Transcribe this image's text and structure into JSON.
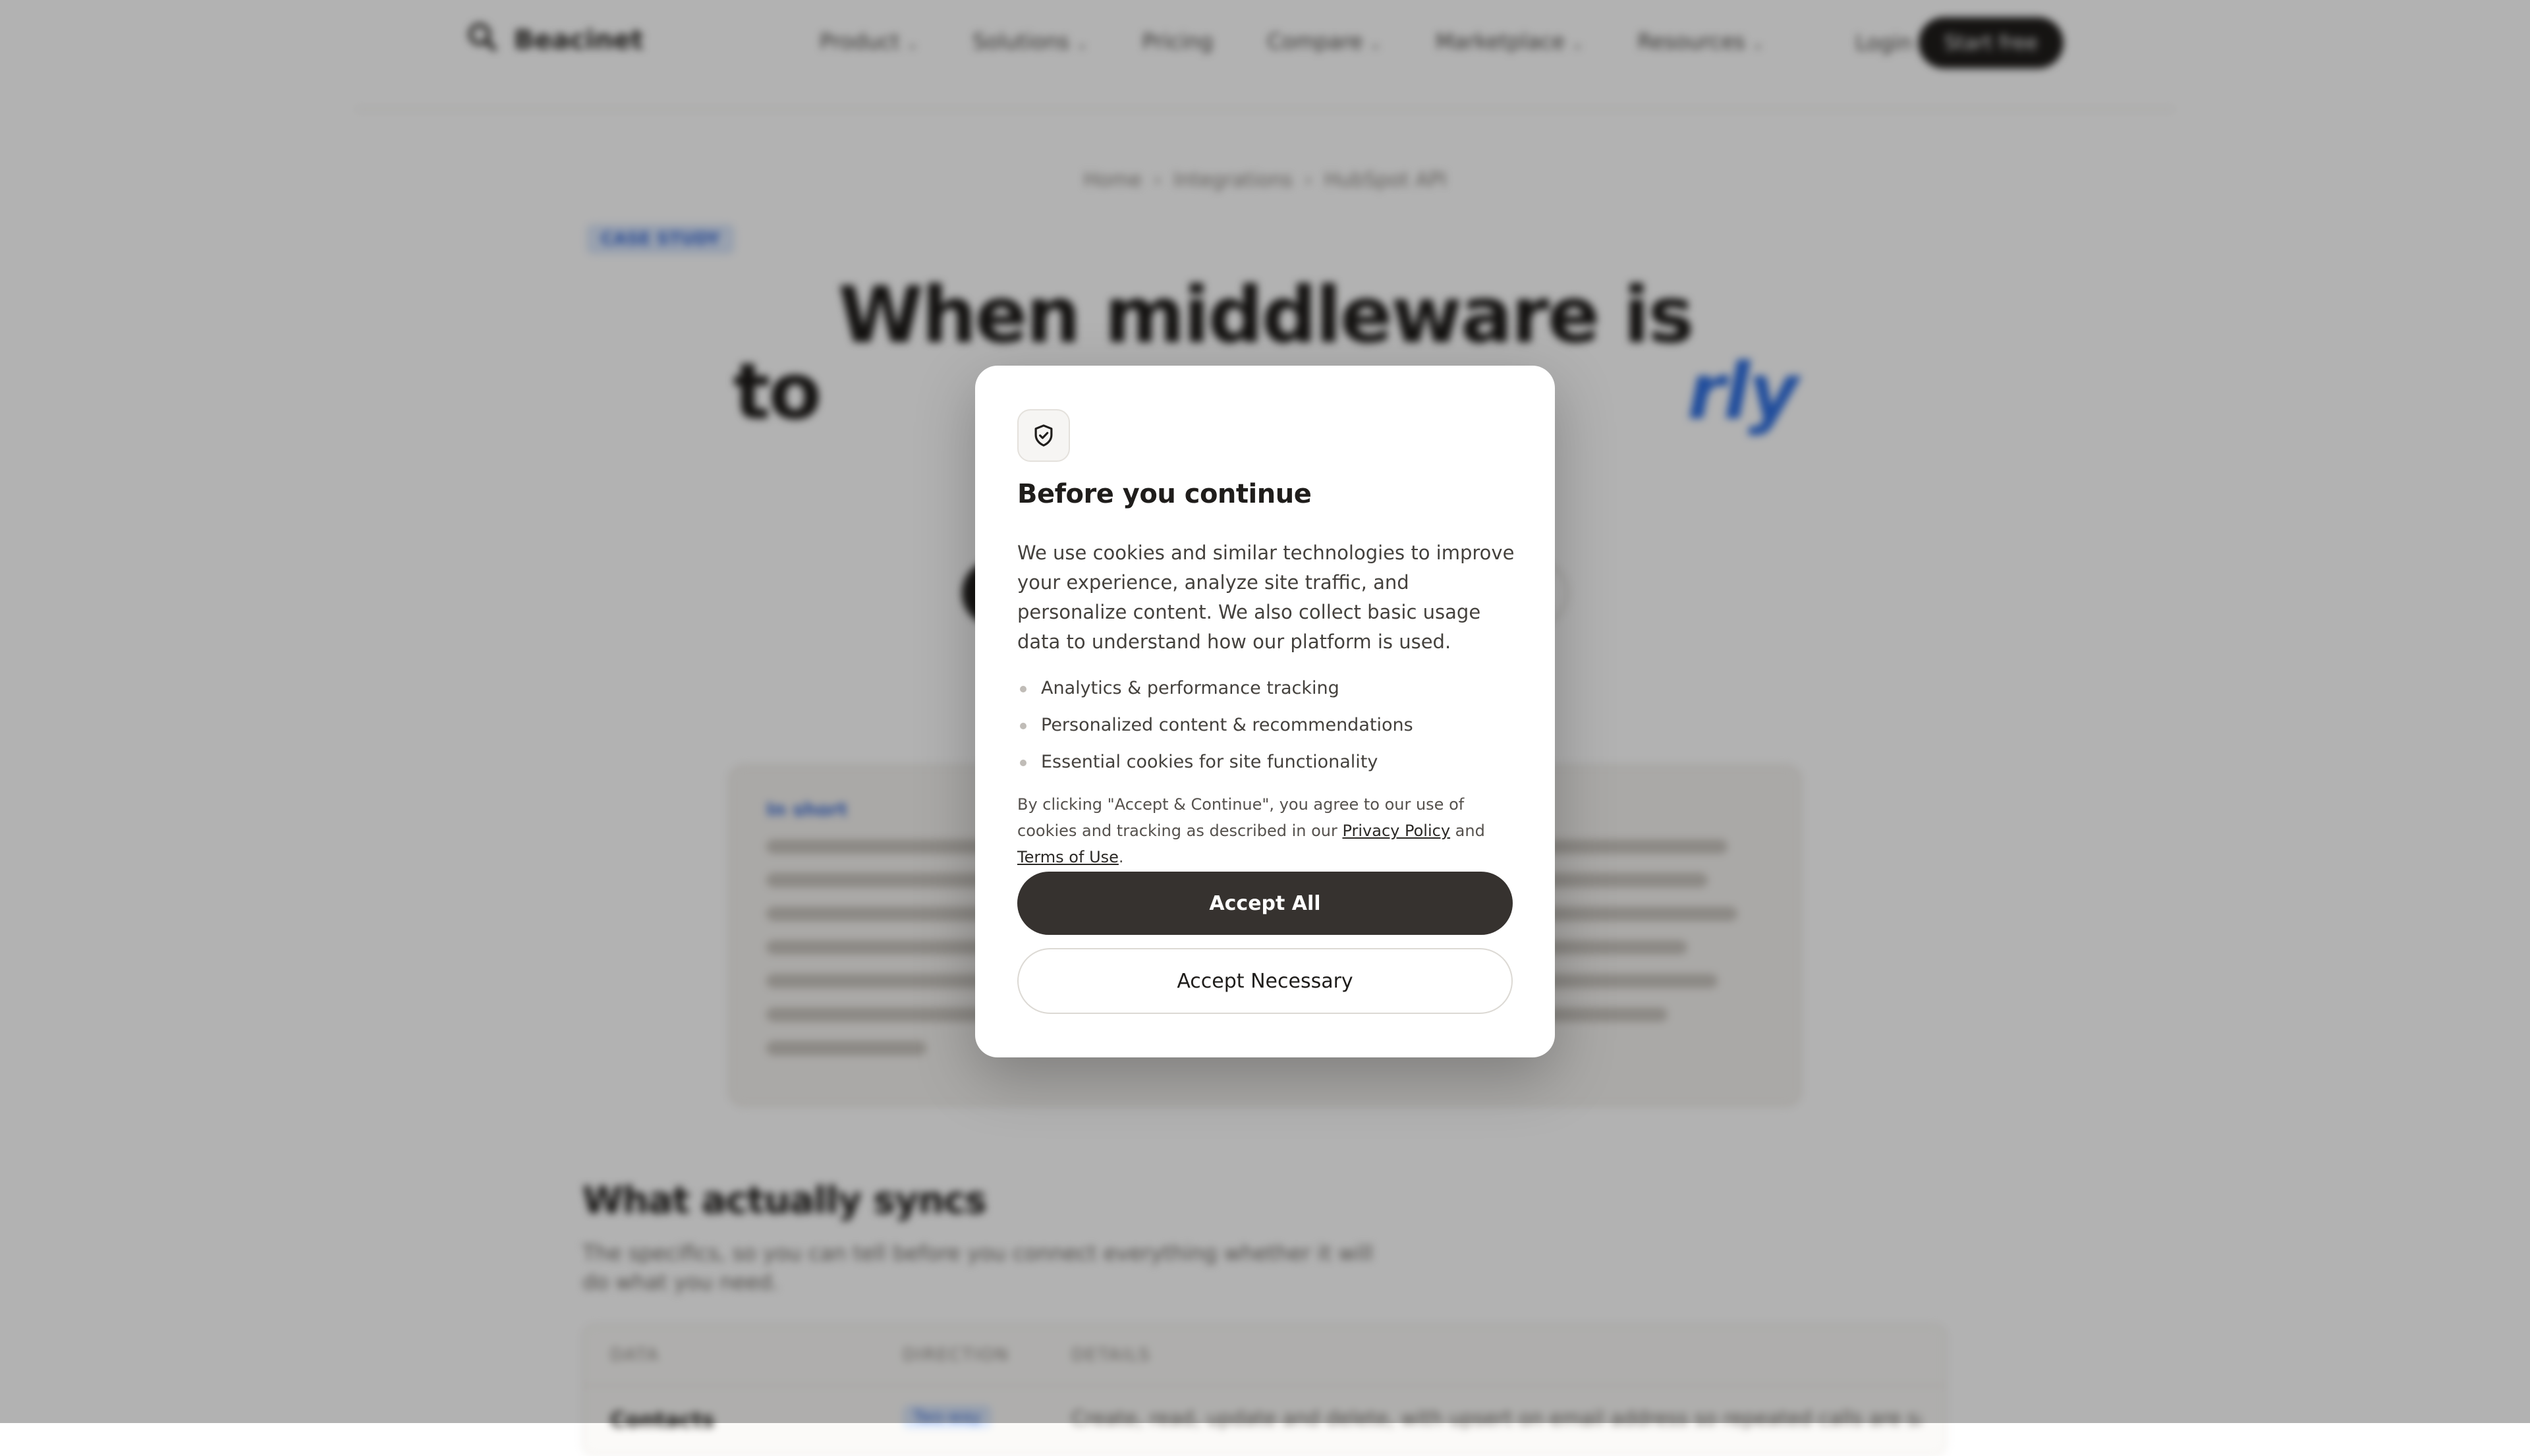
{
  "nav": {
    "brand": "Beacinet",
    "items": [
      {
        "label": "Product"
      },
      {
        "label": "Solutions"
      },
      {
        "label": "Pricing"
      },
      {
        "label": "Compare"
      },
      {
        "label": "Marketplace"
      },
      {
        "label": "Resources"
      }
    ],
    "login": "Login",
    "cta": "Start free"
  },
  "breadcrumb": [
    "Home",
    "Integrations",
    "HubSpot API"
  ],
  "hero": {
    "tag": "CASE STUDY",
    "title_line1": "When middleware is",
    "title_line2_start": "to",
    "title_line2_accent": "rly",
    "note": ""
  },
  "summary": {
    "label": "In short"
  },
  "section": {
    "title": "What actually syncs",
    "subtitle": "The specifics, so you can tell before you connect everything whether it will do what you need."
  },
  "table": {
    "headers": [
      "DATA",
      "DIRECTION",
      "DETAILS"
    ],
    "row": {
      "entity": "Contacts",
      "direction": "Two-way",
      "notes": "Create, read, update and delete, with upsert on email address so repeated calls are safe. Custom"
    }
  },
  "modal": {
    "icon": "shield-check-icon",
    "title": "Before you continue",
    "body": "We use cookies and similar technologies to improve your experience, analyze site traffic, and personalize content. We also collect basic usage data to understand how our platform is used.",
    "list": [
      "Analytics & performance tracking",
      "Personalized content & recommendations",
      "Essential cookies for site functionality"
    ],
    "legal_prefix": "By clicking \"Accept & Continue\", you agree to our use of cookies and tracking as described in our ",
    "privacy_link": "Privacy Policy",
    "legal_and": " and ",
    "terms_link": "Terms of Use",
    "legal_suffix": ".",
    "accept_all": "Accept All",
    "accept_necessary": "Accept Necessary"
  },
  "colors": {
    "accent": "#2f6fe0",
    "primary_button": "#36322f",
    "overlay": "rgba(0,0,0,0.30)"
  }
}
